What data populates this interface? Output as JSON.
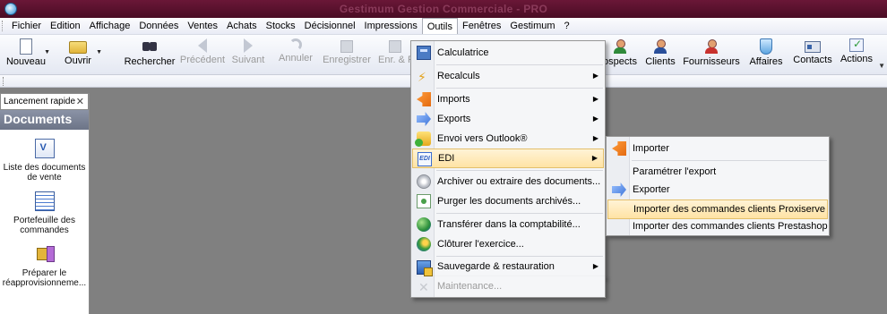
{
  "window": {
    "title": "Gestimum Gestion Commerciale - PRO"
  },
  "menubar": {
    "items": [
      "Fichier",
      "Edition",
      "Affichage",
      "Données",
      "Ventes",
      "Achats",
      "Stocks",
      "Décisionnel",
      "Impressions",
      "Outils",
      "Fenêtres",
      "Gestimum",
      "?"
    ],
    "active": "Outils"
  },
  "toolbar": {
    "nouveau": "Nouveau",
    "ouvrir": "Ouvrir",
    "rechercher": "Rechercher",
    "precedent": "Précédent",
    "suivant": "Suivant",
    "annuler": "Annuler",
    "enregistrer": "Enregistrer",
    "enr_fe": "Enr. & Fe",
    "prospects": "ospects",
    "clients": "Clients",
    "fournisseurs": "Fournisseurs",
    "affaires": "Affaires",
    "contacts": "Contacts",
    "actions": "Actions"
  },
  "left_panel": {
    "tab": "Lancement rapide",
    "header": "Documents",
    "items": [
      {
        "label": "Liste des documents de vente",
        "icon": "sales-list-icon"
      },
      {
        "label": "Portefeuille des commandes",
        "icon": "orders-portfolio-icon"
      },
      {
        "label": "Préparer le réapprovisionneme...",
        "icon": "restock-icon"
      }
    ]
  },
  "outils_menu": {
    "items": [
      {
        "label": "Calculatrice",
        "icon": "calculator-icon"
      },
      {
        "label": "Recalculs",
        "icon": "lightning-icon"
      },
      {
        "label": "Imports",
        "icon": "import-arrow-icon"
      },
      {
        "label": "Exports",
        "icon": "export-arrow-icon"
      },
      {
        "label": "Envoi vers Outlook®",
        "icon": "outlook-icon"
      },
      {
        "label": "EDI",
        "icon": "edi-icon"
      },
      {
        "label": "Archiver ou extraire des documents...",
        "icon": "archive-disc-icon"
      },
      {
        "label": "Purger les documents archivés...",
        "icon": "purge-icon"
      },
      {
        "label": "Transférer dans la comptabilité...",
        "icon": "globe-transfer-icon"
      },
      {
        "label": "Clôturer l'exercice...",
        "icon": "globe-close-icon"
      },
      {
        "label": "Sauvegarde & restauration",
        "icon": "backup-icon"
      },
      {
        "label": "Maintenance...",
        "icon": "maintenance-icon"
      }
    ]
  },
  "edi_submenu": {
    "items": [
      {
        "label": "Importer",
        "icon": "import-arrow-icon"
      },
      {
        "label": "Paramétrer l'export"
      },
      {
        "label": "Exporter",
        "icon": "export-arrow-icon"
      },
      {
        "label": "Importer des commandes clients Proxiserve"
      },
      {
        "label": "Importer des commandes clients Prestashop"
      }
    ]
  },
  "colors": {
    "titlebar": "#5a1230",
    "highlight": "#ffe3a4",
    "workspace": "#808080"
  }
}
